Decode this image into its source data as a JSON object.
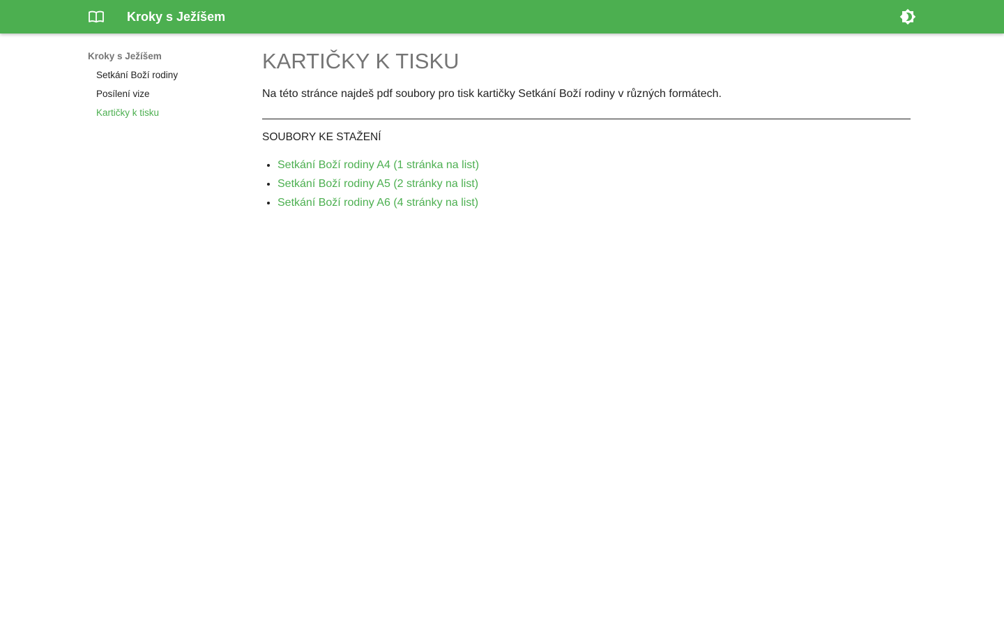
{
  "header": {
    "title": "Kroky s Ježíšem",
    "menu_icon": "book-open-icon",
    "theme_icon": "brightness-icon",
    "background_color": "#4caf50"
  },
  "sidebar": {
    "root_label": "Kroky s Ježíšem",
    "items": [
      {
        "label": "Setkání Boží rodiny",
        "active": false
      },
      {
        "label": "Posílení vize",
        "active": false
      },
      {
        "label": "Kartičky k tisku",
        "active": true
      }
    ]
  },
  "main": {
    "title": "KARTIČKY K TISKU",
    "intro": "Na této stránce najdeš pdf soubory pro tisk kartičky Setkání Boží rodiny v různých formátech.",
    "downloads_heading": "SOUBORY KE STAŽENÍ",
    "downloads": [
      {
        "label": "Setkání Boží rodiny A4 (1 stránka na list)"
      },
      {
        "label": "Setkání Boží rodiny A5 (2 stránky na list)"
      },
      {
        "label": "Setkání Boží rodiny A6 (4 stránky na list)"
      }
    ]
  },
  "colors": {
    "accent": "#4caf50",
    "muted_heading": "#757575",
    "text": "#222222"
  }
}
